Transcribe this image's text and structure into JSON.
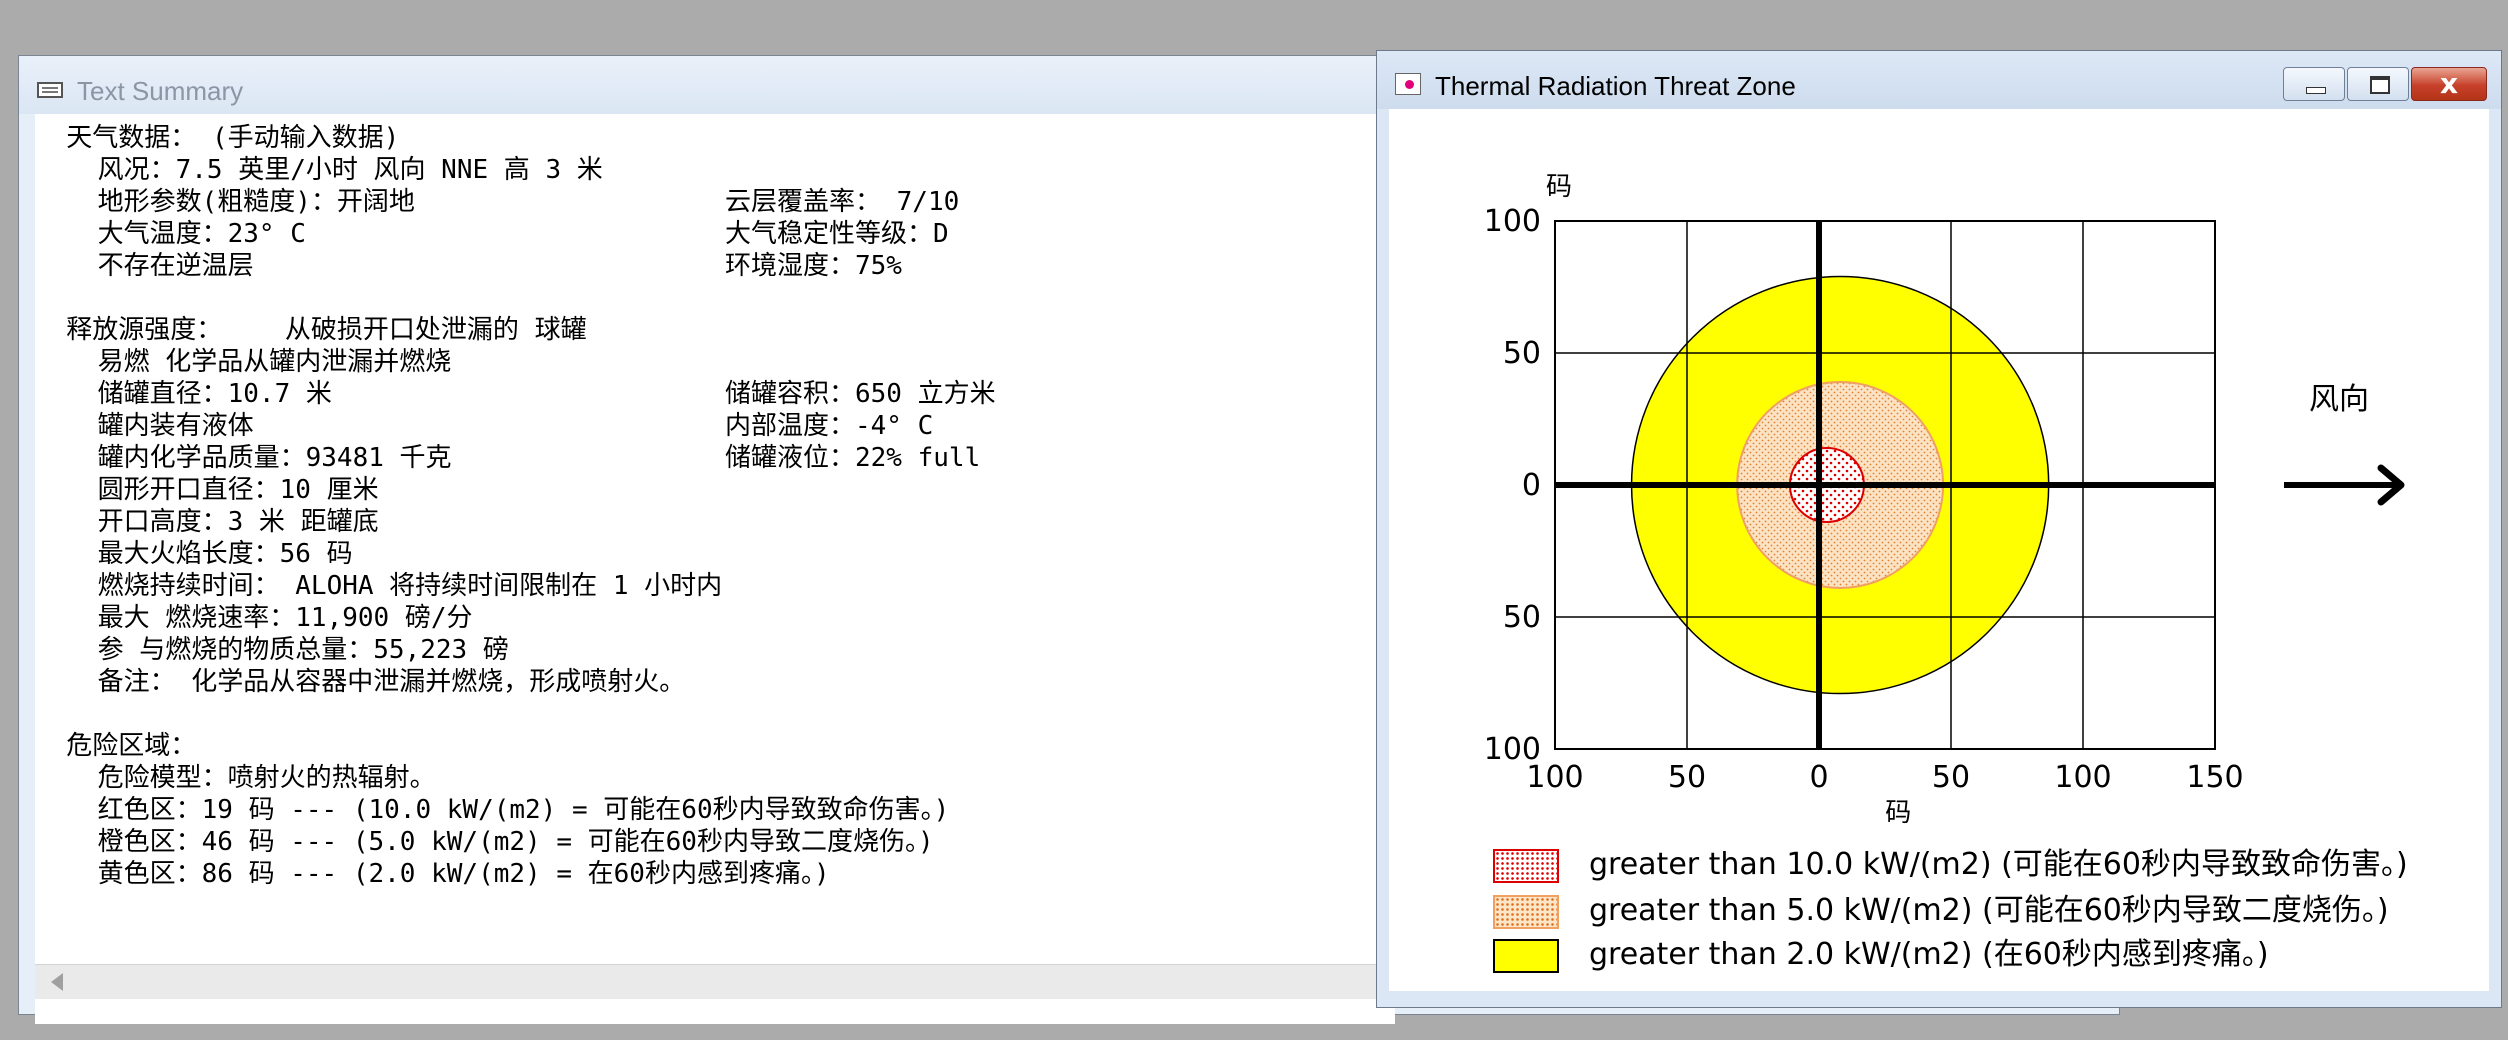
{
  "text_window": {
    "title": "Text Summary",
    "lines": [
      {
        "col1": "  天气数据： (手动输入数据)",
        "col2": ""
      },
      {
        "col1": "    风况：7.5 英里/小时 风向 NNE 高 3 米",
        "col2": ""
      },
      {
        "col1": "    地形参数(粗糙度)：开阔地",
        "col2": "云层覆盖率： 7/10"
      },
      {
        "col1": "    大气温度：23° C",
        "col2": "大气稳定性等级：D"
      },
      {
        "col1": "    不存在逆温层",
        "col2": "环境湿度：75%"
      },
      {
        "col1": "",
        "col2": ""
      },
      {
        "col1": "  释放源强度：    从破损开口处泄漏的 球罐",
        "col2": ""
      },
      {
        "col1": "    易燃 化学品从罐内泄漏并燃烧",
        "col2": ""
      },
      {
        "col1": "    储罐直径：10.7 米",
        "col2": "储罐容积：650 立方米"
      },
      {
        "col1": "    罐内装有液体",
        "col2": "内部温度：-4° C"
      },
      {
        "col1": "    罐内化学品质量：93481 千克",
        "col2": "储罐液位：22% full"
      },
      {
        "col1": "    圆形开口直径：10 厘米",
        "col2": ""
      },
      {
        "col1": "    开口高度：3 米 距罐底",
        "col2": ""
      },
      {
        "col1": "    最大火焰长度：56 码",
        "col2": ""
      },
      {
        "col1": "    燃烧持续时间： ALOHA 将持续时间限制在 1 小时内",
        "col2": ""
      },
      {
        "col1": "    最大 燃烧速率：11,900 磅/分",
        "col2": ""
      },
      {
        "col1": "    参 与燃烧的物质总量：55,223 磅",
        "col2": ""
      },
      {
        "col1": "    备注： 化学品从容器中泄漏并燃烧，形成喷射火。",
        "col2": ""
      },
      {
        "col1": "",
        "col2": ""
      },
      {
        "col1": "  危险区域：",
        "col2": ""
      },
      {
        "col1": "    危险模型：喷射火的热辐射。",
        "col2": ""
      },
      {
        "col1": "    红色区：19 码 --- (10.0 kW/(m2) = 可能在60秒内导致致命伤害。)",
        "col2": ""
      },
      {
        "col1": "    橙色区：46 码 --- (5.0 kW/(m2) = 可能在60秒内导致二度烧伤。)",
        "col2": ""
      },
      {
        "col1": "    黄色区：86 码 --- (2.0 kW/(m2) = 在60秒内感到疼痛。)",
        "col2": ""
      }
    ]
  },
  "threat_window": {
    "title": "Thermal Radiation Threat Zone",
    "close_label": "x",
    "wind_label": "风向",
    "legend": [
      {
        "label": "greater than 10.0 kW/(m2) (可能在60秒内导致致命伤害。)",
        "color": "#ffffff",
        "border": "#dd0000",
        "dot": "#dd0000"
      },
      {
        "label": "greater than 5.0 kW/(m2) (可能在60秒内导致二度烧伤。)",
        "color": "#fbe6c8",
        "border": "#f0a060",
        "dot": "#e07020"
      },
      {
        "label": "greater than 2.0 kW/(m2) (在60秒内感到疼痛。)",
        "color": "#ffff00",
        "border": "#000000",
        "dot": ""
      }
    ]
  },
  "chart_data": {
    "type": "area",
    "xlabel": "码",
    "ylabel": "码",
    "xlim": [
      -100,
      150
    ],
    "ylim": [
      -100,
      100
    ],
    "x_tick_labels": [
      "100",
      "50",
      "0",
      "50",
      "100",
      "150"
    ],
    "y_tick_labels": [
      "100",
      "50",
      "0",
      "50",
      "100"
    ],
    "x_ticks": [
      -100,
      -50,
      0,
      50,
      100,
      150
    ],
    "y_ticks": [
      100,
      50,
      0,
      -50,
      -100
    ],
    "grid": true,
    "zones": [
      {
        "name": "yellow",
        "threshold_kw_m2": 2.0,
        "extent_yd": 86,
        "center_x": 8,
        "radius": 79,
        "color": "#ffff00"
      },
      {
        "name": "orange",
        "threshold_kw_m2": 5.0,
        "extent_yd": 46,
        "center_x": 8,
        "radius": 39,
        "color": "#fbe3c4"
      },
      {
        "name": "red",
        "threshold_kw_m2": 10.0,
        "extent_yd": 19,
        "center_x": 3,
        "radius": 14,
        "color": "#ffffff"
      }
    ]
  }
}
